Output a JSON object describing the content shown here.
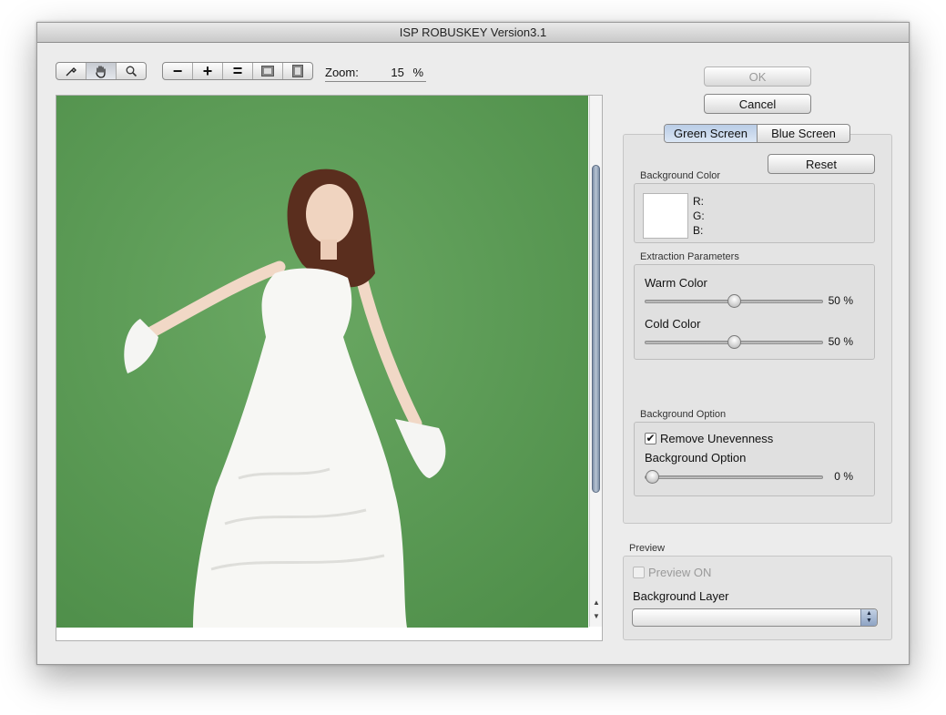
{
  "window": {
    "title": "ISP ROBUSKEY Version3.1"
  },
  "toolbar": {
    "tools": [
      {
        "name": "eyedropper-icon",
        "glyph": "⚲"
      },
      {
        "name": "hand-icon",
        "glyph": "✋"
      },
      {
        "name": "magnifier-icon",
        "glyph": "🔍"
      }
    ],
    "zoom_buttons": [
      {
        "name": "zoom-out-icon",
        "glyph": "−"
      },
      {
        "name": "zoom-in-icon",
        "glyph": "+"
      },
      {
        "name": "actual-size-icon",
        "glyph": "="
      },
      {
        "name": "fit-window-icon",
        "glyph": "▣"
      },
      {
        "name": "fill-window-icon",
        "glyph": "◙"
      }
    ],
    "zoom_label": "Zoom:",
    "zoom_value": "15",
    "zoom_unit": "%"
  },
  "buttons": {
    "ok": "OK",
    "cancel": "Cancel",
    "reset": "Reset"
  },
  "tabs": {
    "green": "Green Screen",
    "blue": "Blue Screen"
  },
  "background_color": {
    "caption": "Background Color",
    "r_label": "R:",
    "g_label": "G:",
    "b_label": "B:",
    "swatch": "#ffffff"
  },
  "extraction": {
    "caption": "Extraction Parameters",
    "warm_label": "Warm Color",
    "warm_value": "50",
    "warm_fraction": 0.5,
    "cold_label": "Cold Color",
    "cold_value": "50",
    "cold_fraction": 0.5,
    "unit": "%"
  },
  "background_option": {
    "caption": "Background Option",
    "remove_unevenness_label": "Remove Unevenness",
    "remove_unevenness_checked": true,
    "option_label": "Background Option",
    "option_value": "0",
    "option_fraction": 0.0,
    "unit": "%"
  },
  "preview": {
    "caption": "Preview",
    "preview_on_label": "Preview ON",
    "background_layer_label": "Background Layer",
    "background_layer_value": ""
  },
  "colors": {
    "green_screen": "#5e9e58",
    "accent": "#b9cce6"
  }
}
